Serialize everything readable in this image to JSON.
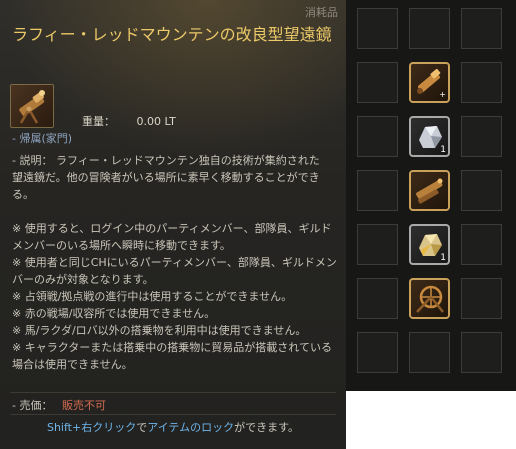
{
  "tooltip": {
    "category": "消耗品",
    "title": "ラフィー・レッドマウンテンの改良型望遠鏡",
    "weight_label": "重量：",
    "weight_value": "0.00 LT",
    "bound": "- 帰属(家門)",
    "description": "- 説明： ラフィー・レッドマウンテン独自の技術が集約された望遠鏡だ。他の冒険者がいる場所に素早く移動することができる。",
    "notes": [
      "※ 使用すると、ログイン中のパーティメンバー、部隊員、ギルドメンバーのいる場所へ瞬時に移動できます。",
      "※ 使用者と同じCHにいるパーティメンバー、部隊員、ギルドメンバーのみが対象となります。",
      "※ 占領戦/拠点戦の進行中は使用することができません。",
      "※ 赤の戦場/収容所では使用できません。",
      "※ 馬/ラクダ/ロバ以外の搭乗物を利用中は使用できません。",
      "※ キャラクターまたは搭乗中の搭乗物に貿易品が搭載されている場合は使用できません。"
    ],
    "price_label": "- 売価：",
    "price_value": "販売不可",
    "hint": {
      "key": "Shift+右クリック",
      "part1": "で",
      "item_lock": "アイテムのロック",
      "part2": "ができます。"
    },
    "accent_color": "#ebc868",
    "price_color": "#d56b52",
    "hint_color": "#6fb4e8"
  },
  "inventory": {
    "rows": 7,
    "cols": 3,
    "items": [
      {
        "row": 1,
        "col": 1,
        "icon": "telescope-icon",
        "badge": "+"
      },
      {
        "row": 2,
        "col": 1,
        "icon": "silver-ore-icon",
        "count": "1"
      },
      {
        "row": 3,
        "col": 1,
        "icon": "telescope-stand-icon"
      },
      {
        "row": 4,
        "col": 1,
        "icon": "gold-ore-icon",
        "count": "1"
      },
      {
        "row": 5,
        "col": 1,
        "icon": "wheel-contraption-icon"
      }
    ]
  }
}
